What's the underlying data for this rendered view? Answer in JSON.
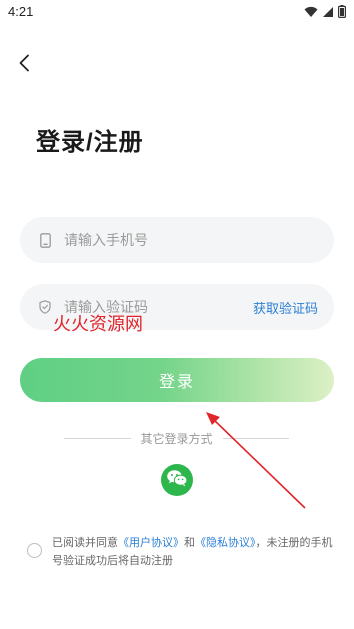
{
  "status_bar": {
    "time": "4:21",
    "icons": [
      "wifi-icon",
      "signal-icon",
      "battery-icon"
    ]
  },
  "nav": {
    "back_icon": "back-chevron-icon"
  },
  "header": {
    "title": "登录/注册"
  },
  "form": {
    "phone": {
      "placeholder": "请输入手机号",
      "value": "",
      "icon": "phone-icon"
    },
    "code": {
      "placeholder": "请输入验证码",
      "value": "",
      "icon": "shield-icon",
      "get_code_label": "获取验证码"
    },
    "login_label": "登录"
  },
  "watermark": {
    "text": "火火资源网"
  },
  "other_login": {
    "label": "其它登录方式",
    "methods": [
      {
        "icon": "wechat-icon"
      }
    ]
  },
  "agreement": {
    "checked": false,
    "prefix": "已阅读并同意",
    "user_agreement": "《用户协议》",
    "and": "和",
    "privacy_policy": "《隐私协议》",
    "suffix": "，未注册的手机号验证成功后将自动注册"
  },
  "colors": {
    "primary_green": "#5fcf84",
    "link_blue": "#2a7fd4",
    "wechat_green": "#2db64b",
    "annotation_red": "#e0262a"
  }
}
